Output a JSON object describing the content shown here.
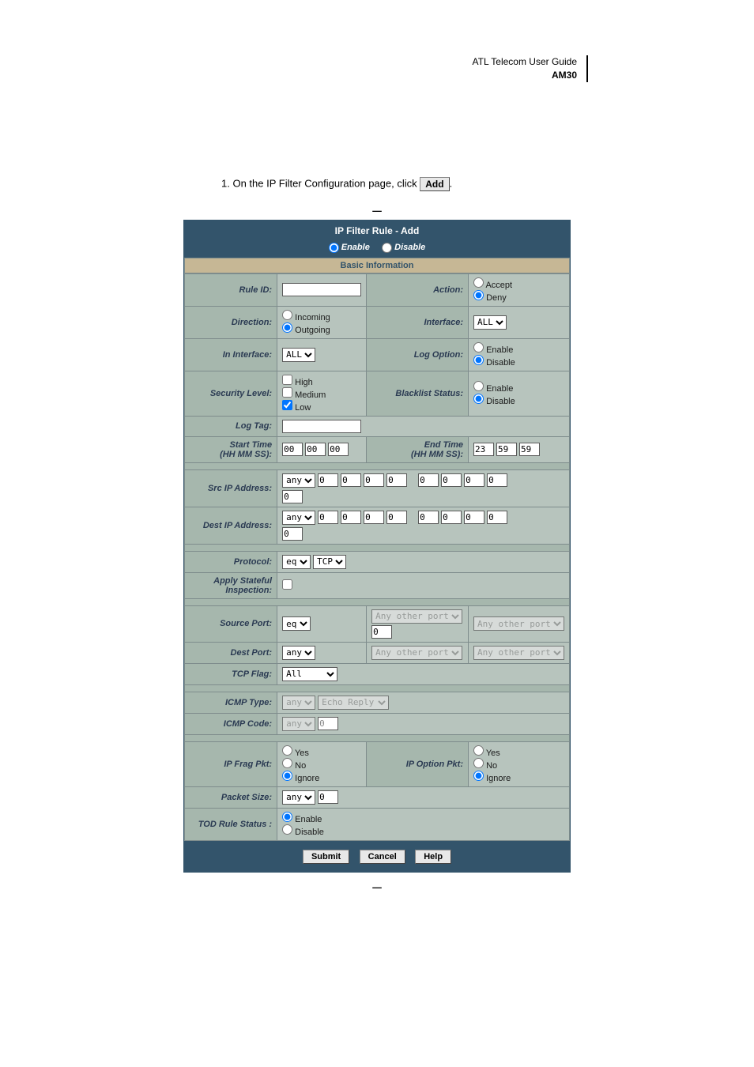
{
  "header": {
    "line1": "ATL Telecom User Guide",
    "line2": "AM30"
  },
  "instruction": {
    "prefix": "1.   On the IP Filter Configuration page, click ",
    "button": "Add",
    "suffix": "."
  },
  "title": "IP Filter Rule - Add",
  "enable_disable": {
    "enable": "Enable",
    "disable": "Disable",
    "selected": "enable"
  },
  "sections": {
    "basic": "Basic Information"
  },
  "labels": {
    "rule_id": "Rule ID:",
    "action": "Action:",
    "direction": "Direction:",
    "interface": "Interface:",
    "in_interface": "In Interface:",
    "log_option": "Log Option:",
    "security_level": "Security Level:",
    "blacklist": "Blacklist Status:",
    "log_tag": "Log Tag:",
    "start_time": "Start Time",
    "start_time_sub": "(HH MM SS):",
    "end_time": "End Time",
    "end_time_sub": "(HH MM SS):",
    "src_ip": "Src IP Address:",
    "dest_ip": "Dest IP Address:",
    "protocol": "Protocol:",
    "apply_stateful": "Apply Stateful",
    "apply_stateful_sub": "Inspection:",
    "source_port": "Source Port:",
    "dest_port": "Dest Port:",
    "tcp_flag": "TCP Flag:",
    "icmp_type": "ICMP Type:",
    "icmp_code": "ICMP Code:",
    "ip_frag": "IP Frag Pkt:",
    "ip_option": "IP Option Pkt:",
    "packet_size": "Packet Size:",
    "tod_rule": "TOD Rule Status :"
  },
  "options": {
    "action": {
      "accept": "Accept",
      "deny": "Deny",
      "selected": "deny"
    },
    "direction": {
      "incoming": "Incoming",
      "outgoing": "Outgoing",
      "selected": "outgoing"
    },
    "interface": {
      "value": "ALL"
    },
    "in_interface": {
      "value": "ALL"
    },
    "log_option": {
      "enable": "Enable",
      "disable": "Disable",
      "selected": "disable"
    },
    "security": {
      "high": "High",
      "medium": "Medium",
      "low": "Low",
      "low_checked": true
    },
    "blacklist": {
      "enable": "Enable",
      "disable": "Disable",
      "selected": "disable"
    },
    "start_time": [
      "00",
      "00",
      "00"
    ],
    "end_time": [
      "23",
      "59",
      "59"
    ],
    "src_ip": {
      "type": "any",
      "addr": [
        "0",
        "0",
        "0",
        "0"
      ],
      "mask": [
        "0",
        "0",
        "0",
        "0"
      ],
      "below": "0"
    },
    "dest_ip": {
      "type": "any",
      "addr": [
        "0",
        "0",
        "0",
        "0"
      ],
      "mask": [
        "0",
        "0",
        "0",
        "0"
      ],
      "below": "0"
    },
    "protocol": {
      "op": "eq",
      "proto": "TCP"
    },
    "source_port": {
      "op": "eq",
      "port1": "Any other port",
      "val1": "0",
      "port2": "Any other port"
    },
    "dest_port": {
      "op": "any",
      "port1": "Any other port",
      "port2": "Any other port"
    },
    "tcp_flag": "All",
    "icmp_type": {
      "op": "any",
      "val": "Echo Reply"
    },
    "icmp_code": {
      "op": "any",
      "val": "0"
    },
    "ip_frag": {
      "yes": "Yes",
      "no": "No",
      "ignore": "Ignore",
      "selected": "ignore"
    },
    "ip_option": {
      "yes": "Yes",
      "no": "No",
      "ignore": "Ignore",
      "selected": "ignore"
    },
    "packet_size": {
      "op": "any",
      "val": "0"
    },
    "tod_rule": {
      "enable": "Enable",
      "disable": "Disable",
      "selected": "enable"
    }
  },
  "buttons": {
    "submit": "Submit",
    "cancel": "Cancel",
    "help": "Help"
  }
}
